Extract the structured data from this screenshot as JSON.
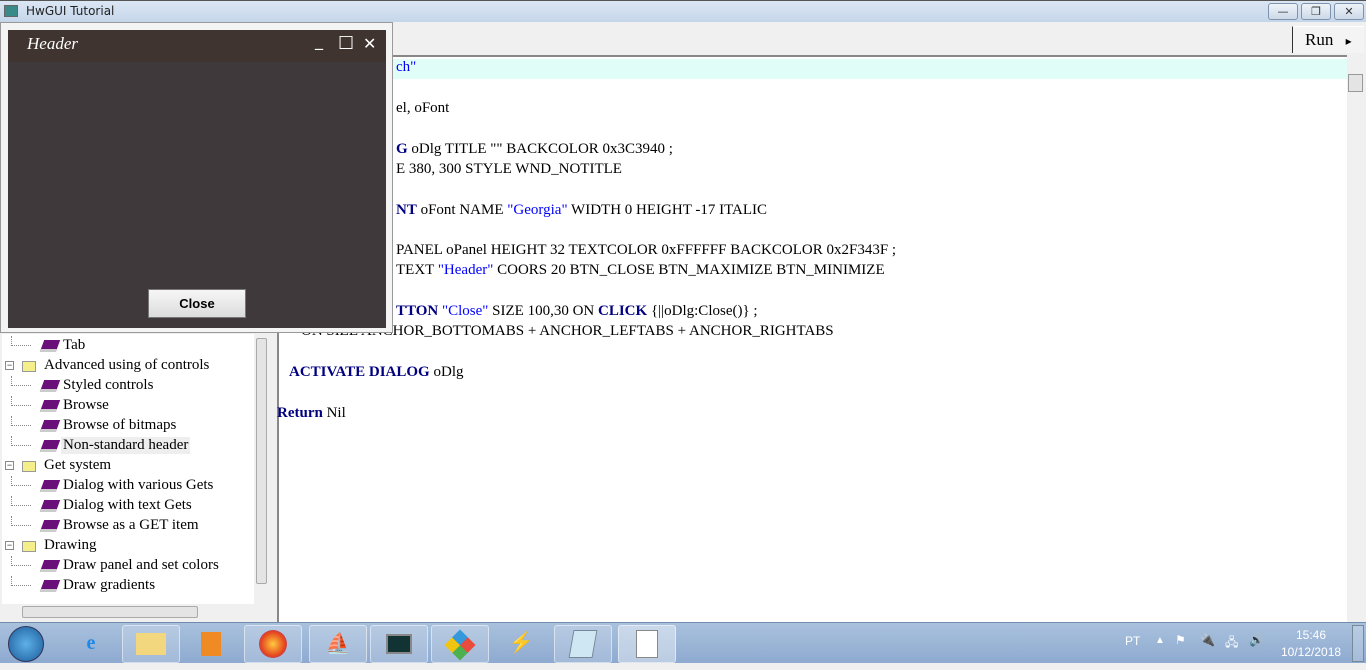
{
  "window": {
    "title": "HwGUI Tutorial",
    "minimize": "—",
    "restore": "❐",
    "close": "✕"
  },
  "toolbar": {
    "run_label": "Run",
    "run_arrow": "▸"
  },
  "dialog": {
    "title": "Header",
    "minimize": "_",
    "maximize": "☐",
    "close": "✕",
    "close_button": "Close",
    "header_color": "#3f342f",
    "body_color": "#40393c"
  },
  "tree": {
    "items": [
      {
        "label": "Tab",
        "type": "leaf"
      },
      {
        "label": "Advanced using of controls",
        "type": "folder"
      },
      {
        "label": "Styled controls",
        "type": "leaf"
      },
      {
        "label": "Browse",
        "type": "leaf"
      },
      {
        "label": "Browse of bitmaps",
        "type": "leaf"
      },
      {
        "label": "Non-standard header",
        "type": "leaf",
        "selected": true
      },
      {
        "label": "Get system",
        "type": "folder"
      },
      {
        "label": "Dialog with various Gets",
        "type": "leaf"
      },
      {
        "label": "Dialog with text Gets",
        "type": "leaf"
      },
      {
        "label": "Browse as a GET item",
        "type": "leaf"
      },
      {
        "label": "Drawing",
        "type": "folder"
      },
      {
        "label": "Draw panel and set colors",
        "type": "leaf"
      },
      {
        "label": "Draw gradients",
        "type": "leaf"
      }
    ]
  },
  "code": {
    "l1": "ch\"",
    "l3": "el, oFont",
    "l5a": "G",
    "l5b": " oDlg TITLE \"\" BACKCOLOR 0x3C3940 ;",
    "l6": "E 380, 300 STYLE WND_NOTITLE",
    "l8a": "NT",
    "l8b": " oFont NAME ",
    "l8c": "\"Georgia\"",
    "l8d": " WIDTH 0 HEIGHT -17 ITALIC",
    "l10": "PANEL oPanel HEIGHT 32 TEXTCOLOR 0xFFFFFF BACKCOLOR 0x2F343F ;",
    "l11a": "TEXT ",
    "l11b": "\"Header\"",
    "l11c": " COORS 20 BTN_CLOSE BTN_MAXIMIZE BTN_MINIMIZE",
    "l13a": "TTON",
    "l13b": "\"Close\"",
    "l13c": " SIZE 100,30 ON ",
    "l13d": "CLICK",
    "l13e": " {||oDlg:Close()} ;",
    "l14": "ON SIZE ANCHOR_BOTTOMABS + ANCHOR_LEFTABS + ANCHOR_RIGHTABS",
    "l16a": "ACTIVATE DIALOG",
    "l16b": " oDlg",
    "l18a": "Return",
    "l18b": " Nil"
  },
  "taskbar": {
    "language": "PT",
    "time": "15:46",
    "date": "10/12/2018"
  }
}
